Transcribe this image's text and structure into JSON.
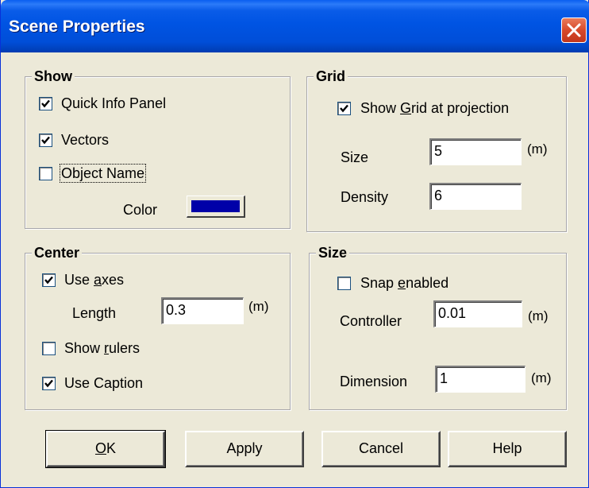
{
  "window": {
    "title": "Scene Properties",
    "close_icon": "close-icon"
  },
  "show": {
    "legend": "Show",
    "quick_info": {
      "label": "Quick Info Panel",
      "checked": true
    },
    "vectors": {
      "label": "Vectors",
      "checked": true
    },
    "object_name": {
      "label": "Object Name",
      "checked": false
    },
    "color_label": "Color",
    "color_value": "#0000a8"
  },
  "grid": {
    "legend": "Grid",
    "show_grid": {
      "label_pre": "Show ",
      "label_mnemonic": "G",
      "label_post": "rid at projection",
      "checked": true
    },
    "size_label": "Size",
    "size_value": "5",
    "size_unit": "(m)",
    "density_label": "Density",
    "density_value": "6"
  },
  "center": {
    "legend": "Center",
    "use_axes": {
      "label_pre": "Use ",
      "label_mnemonic": "a",
      "label_post": "xes",
      "checked": true
    },
    "length_label": "Length",
    "length_value": "0.3",
    "length_unit": "(m)",
    "show_rulers": {
      "label_pre": "Show ",
      "label_mnemonic": "r",
      "label_post": "ulers",
      "checked": false
    },
    "use_caption": {
      "label": "Use Caption",
      "checked": true
    }
  },
  "size": {
    "legend": "Size",
    "snap": {
      "label_pre": "Snap ",
      "label_mnemonic": "e",
      "label_post": "nabled",
      "checked": false
    },
    "controller_label": "Controller",
    "controller_value": "0.01",
    "controller_unit": "(m)",
    "dimension_label": "Dimension",
    "dimension_value": "1",
    "dimension_unit": "(m)"
  },
  "buttons": {
    "ok_mnemonic": "O",
    "ok_rest": "K",
    "apply": "Apply",
    "cancel": "Cancel",
    "help": "Help"
  }
}
